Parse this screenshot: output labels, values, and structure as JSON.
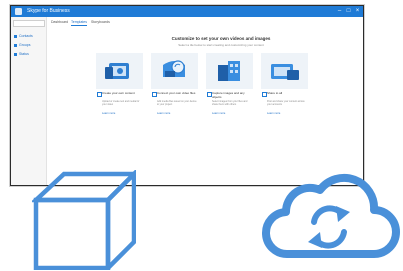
{
  "window": {
    "title": "Skype for Business",
    "controls": [
      "–",
      "□",
      "×"
    ]
  },
  "sidebar": {
    "search_placeholder": "",
    "items": [
      {
        "label": "Contacts"
      },
      {
        "label": "Groups"
      },
      {
        "label": "Status"
      }
    ]
  },
  "nav": {
    "tabs": [
      {
        "label": "Dashboard"
      },
      {
        "label": "Templates"
      },
      {
        "label": "Storyboards"
      }
    ]
  },
  "main": {
    "heading": "Customize to set your own videos and images",
    "subheading": "Select a tile below to start creating and customizing your content"
  },
  "cards": [
    {
      "title": "Create your own content",
      "desc": "Upload or create text and media for your video",
      "link": "Learn more"
    },
    {
      "title": "Connect your own video files",
      "desc": "Add media files saved on your device to your project",
      "link": "Learn more"
    },
    {
      "title": "Capture images and any objects",
      "desc": "Select images from your files and share them with others",
      "link": "Learn more"
    },
    {
      "title": "Share to all",
      "desc": "Post and share your content across your accounts",
      "link": "Learn more"
    }
  ],
  "colors": {
    "accent": "#1f7bd6",
    "icon_blue": "#4a90d9"
  },
  "icons": {
    "cube": "cube-icon",
    "cloud": "cloud-sync-icon"
  }
}
